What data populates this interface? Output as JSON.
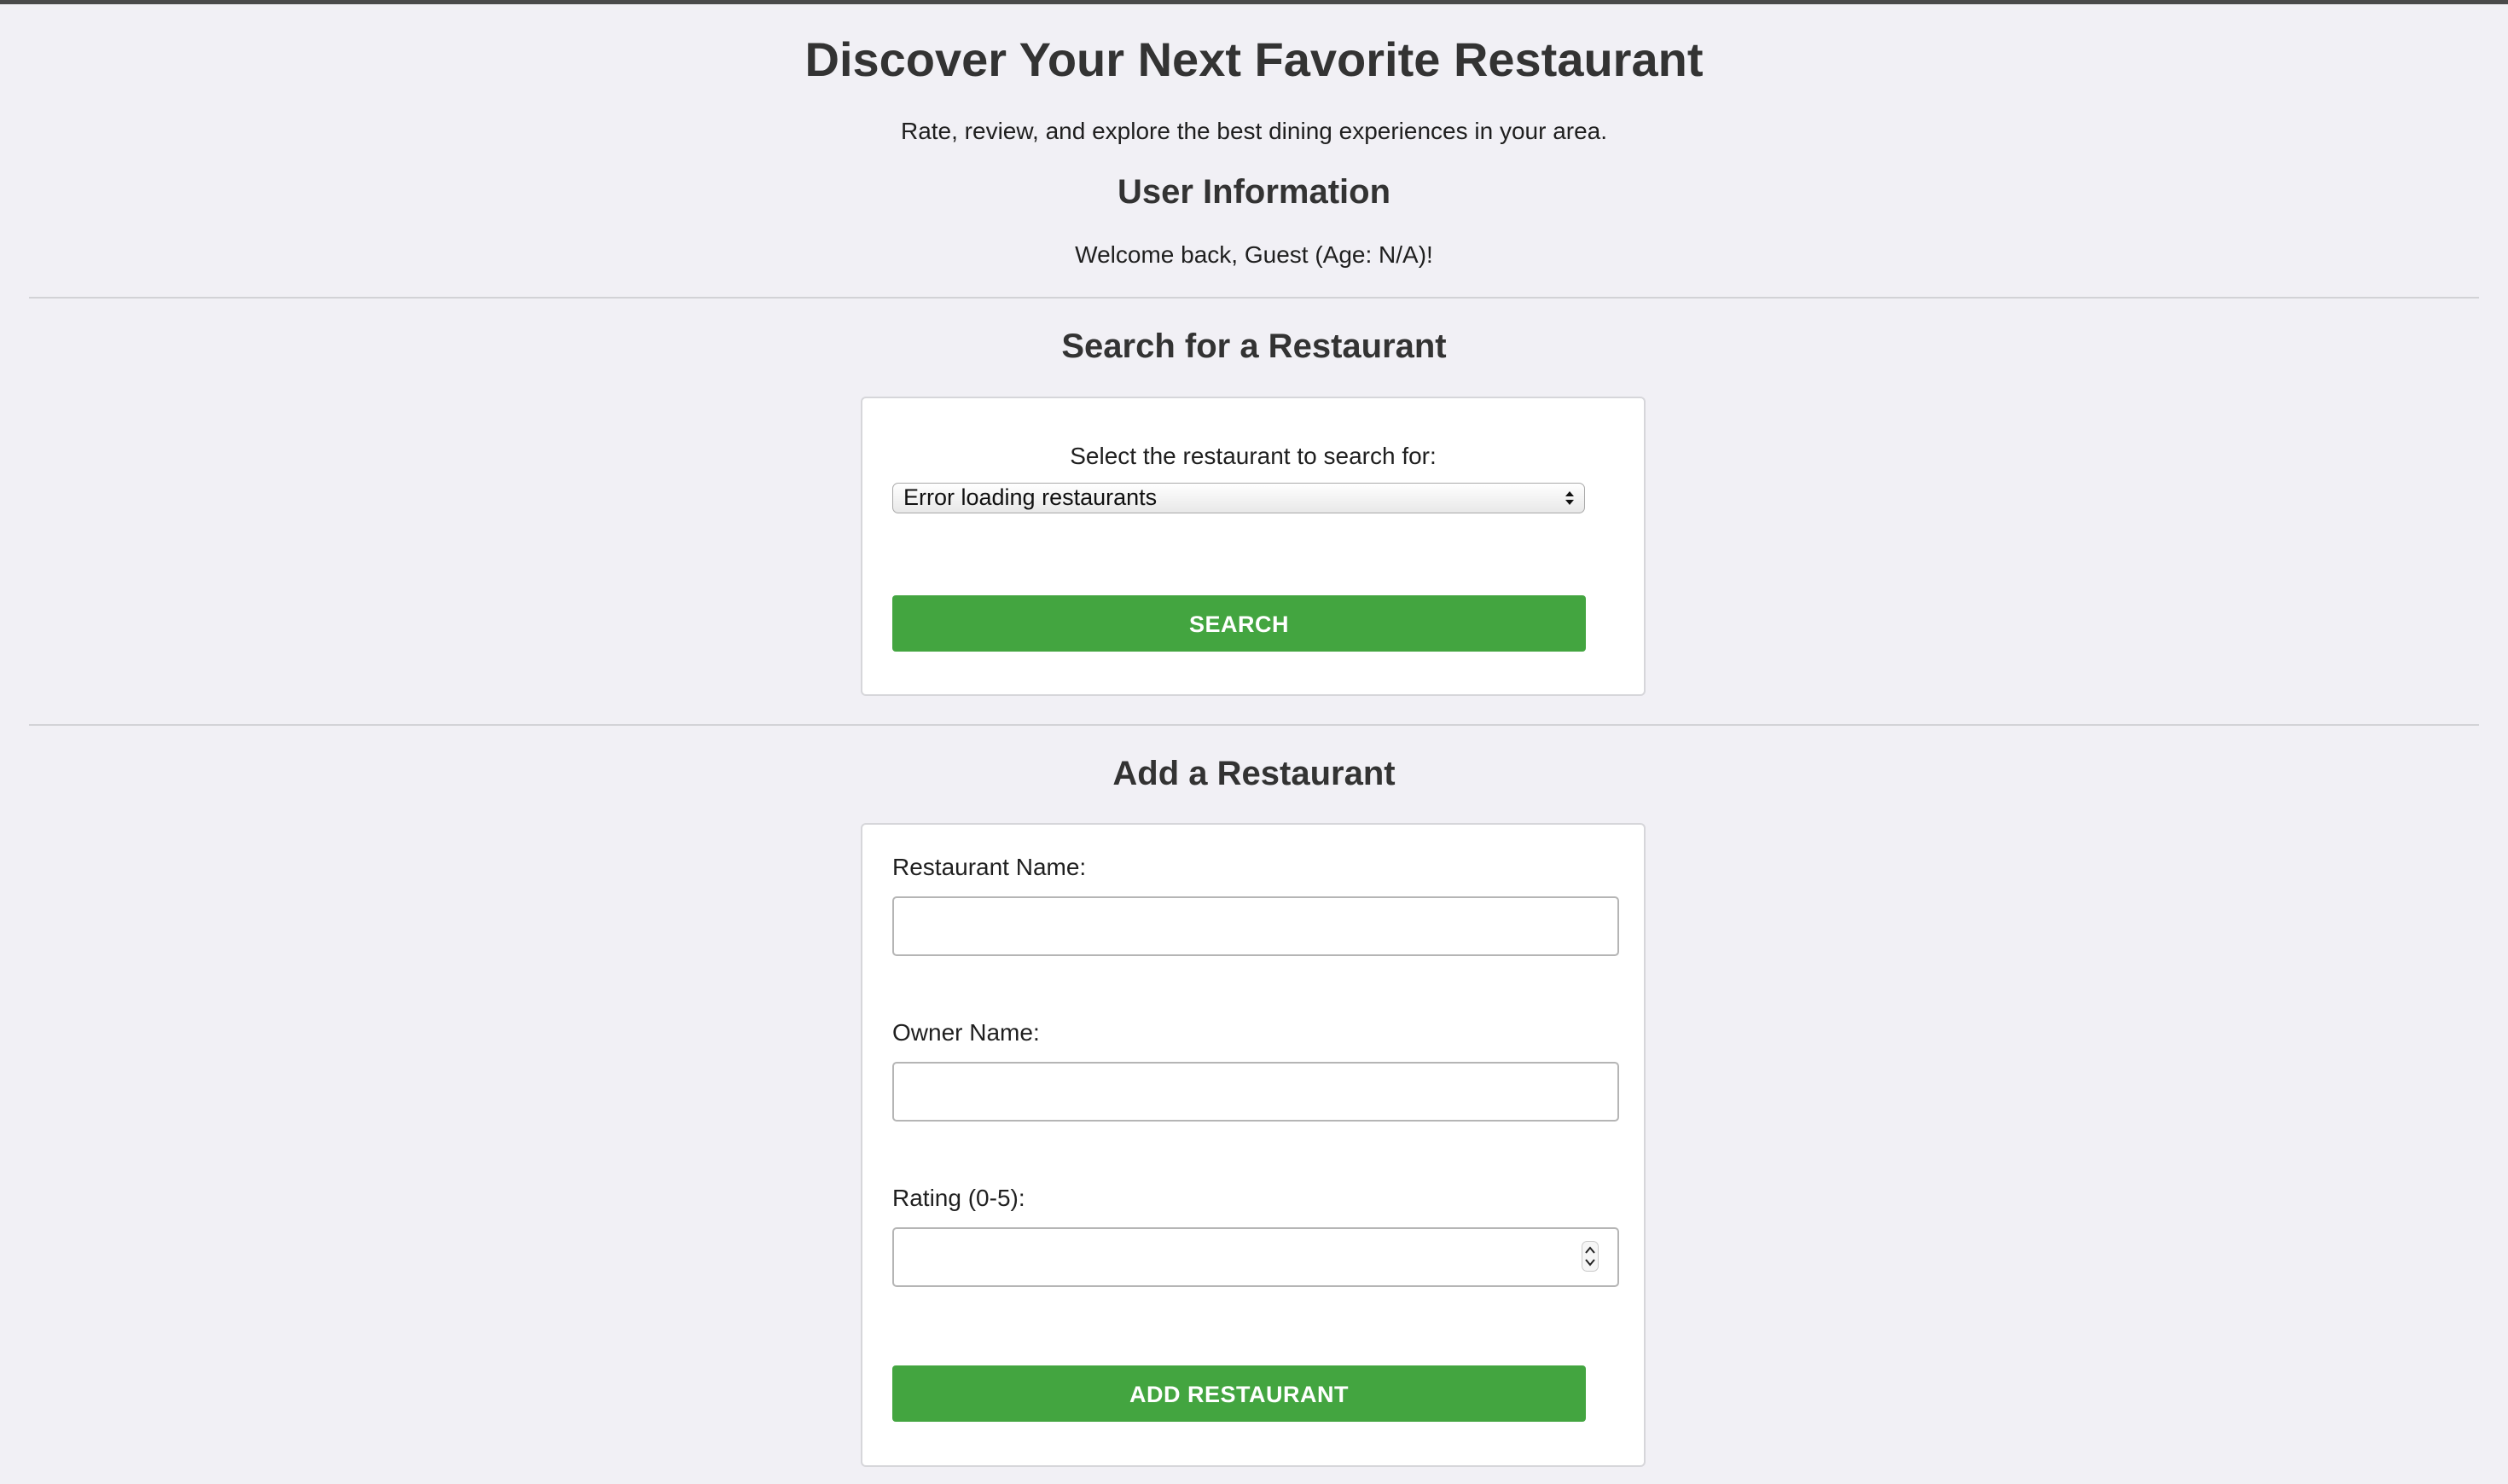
{
  "header": {
    "title": "Discover Your Next Favorite Restaurant",
    "tagline": "Rate, review, and explore the best dining experiences in your area."
  },
  "user_info": {
    "heading": "User Information",
    "welcome": "Welcome back, Guest (Age: N/A)!"
  },
  "search": {
    "heading": "Search for a Restaurant",
    "label": "Select the restaurant to search for:",
    "selected_option": "Error loading restaurants",
    "button_label": "SEARCH"
  },
  "add_restaurant": {
    "heading": "Add a Restaurant",
    "name_label": "Restaurant Name:",
    "name_value": "",
    "owner_label": "Owner Name:",
    "owner_value": "",
    "rating_label": "Rating (0-5):",
    "rating_value": "",
    "button_label": "ADD RESTAURANT"
  },
  "colors": {
    "accent_button": "#43a540",
    "page_background": "#f1f0f5"
  }
}
